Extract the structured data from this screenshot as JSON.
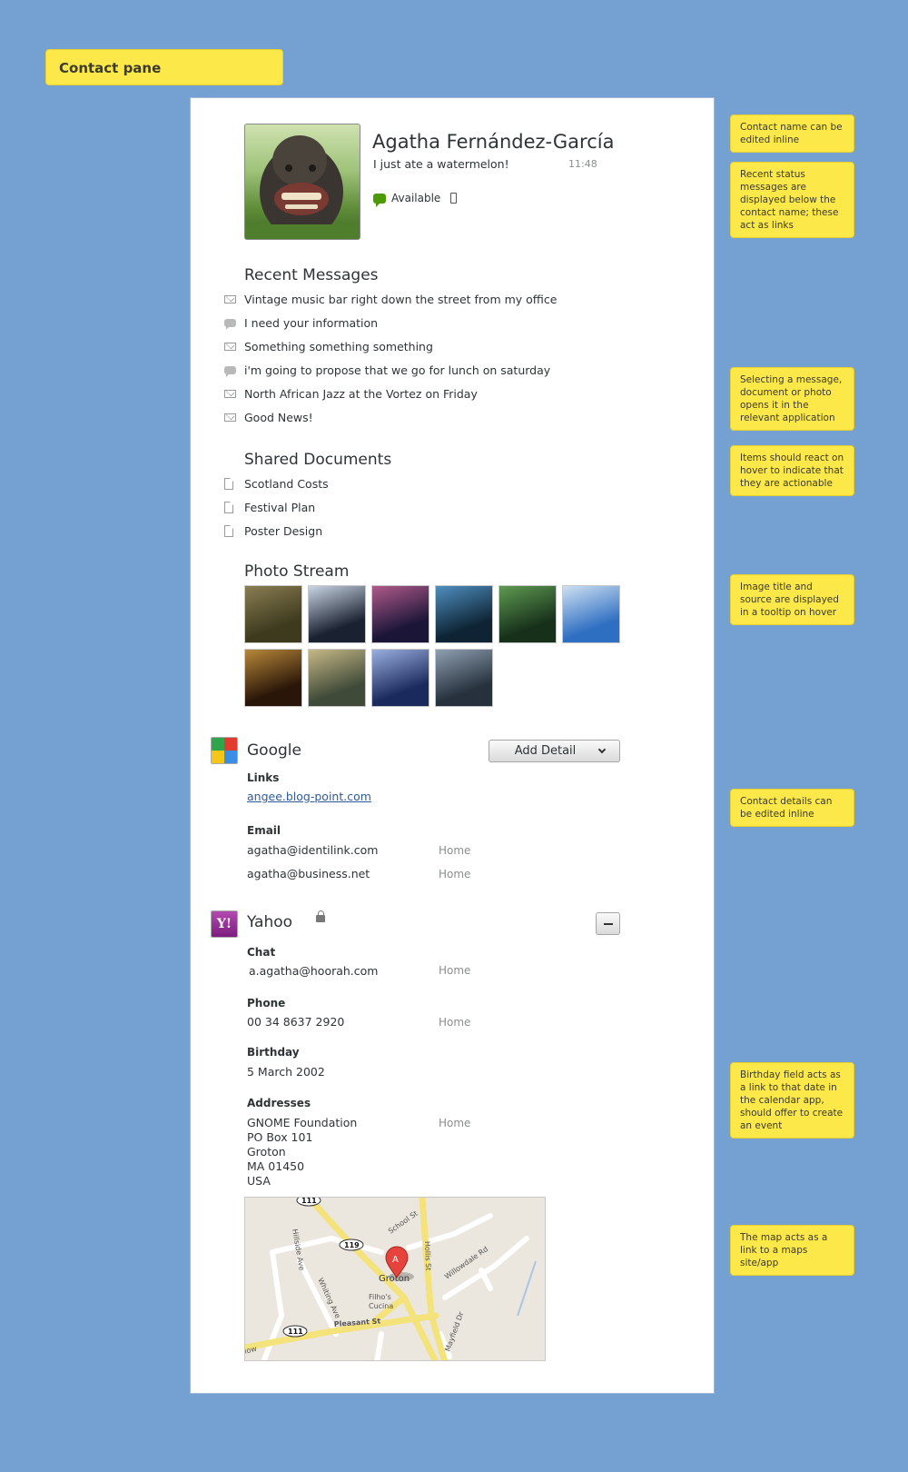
{
  "title": "Contact pane",
  "notes": [
    "Contact name can be edited inline",
    "Recent status messages are displayed below the contact name; these act as links",
    "Selecting a message, document or photo opens it in the relevant application",
    "Items should react on hover to indicate that they are actionable",
    "Image title and source are displayed in a tooltip on hover",
    "Contact details can be edited inline",
    "Birthday field acts as a link to that date in the calendar app, should offer to create an event",
    "The map acts as a link to a maps site/app"
  ],
  "contact": {
    "name": "Agatha Fernández-García",
    "status_message": "I just ate a watermelon!",
    "status_time": "11:48",
    "presence": "Available"
  },
  "recent_messages": {
    "heading": "Recent Messages",
    "items": [
      {
        "type": "mail-icon",
        "text": "Vintage music bar right down the street from my office"
      },
      {
        "type": "chat-icon",
        "text": "I need your information"
      },
      {
        "type": "mail-icon",
        "text": "Something something something"
      },
      {
        "type": "chat-icon",
        "text": "i'm going to propose that we go for lunch on saturday"
      },
      {
        "type": "mail-icon",
        "text": "North African Jazz at the Vortez on Friday"
      },
      {
        "type": "mail-icon",
        "text": "Good News!"
      }
    ]
  },
  "shared_documents": {
    "heading": "Shared Documents",
    "items": [
      "Scotland Costs",
      "Festival Plan",
      "Poster Design"
    ]
  },
  "photo_stream": {
    "heading": "Photo Stream",
    "colors": [
      [
        "#3d3a1e",
        "#8a7d52"
      ],
      [
        "#1a2130",
        "#c9d6e4"
      ],
      [
        "#1b1538",
        "#b05a8a"
      ],
      [
        "#0e2435",
        "#4f8fbf"
      ],
      [
        "#16301a",
        "#5f9a52"
      ],
      [
        "#2f6fc2",
        "#cfe0f2"
      ],
      [
        "#2a1608",
        "#b8883a"
      ],
      [
        "#3f4a38",
        "#c7b887"
      ],
      [
        "#1b2a5c",
        "#9ab0e0"
      ],
      [
        "#26313d",
        "#8fa0b2"
      ]
    ]
  },
  "google": {
    "name": "Google",
    "add_detail_label": "Add Detail",
    "links_label": "Links",
    "link": "angee.blog-point.com",
    "email_label": "Email",
    "emails": [
      {
        "value": "agatha@identilink.com",
        "type": "Home"
      },
      {
        "value": "agatha@business.net",
        "type": "Home"
      }
    ]
  },
  "yahoo": {
    "name": "Yahoo",
    "logo_text": "Y!",
    "chat_label": "Chat",
    "chat_value": "a.agatha@hoorah.com",
    "chat_type": "Home",
    "phone_label": "Phone",
    "phone_value": "00 34 8637 2920",
    "phone_type": "Home",
    "birthday_label": "Birthday",
    "birthday_value": "5 March 2002",
    "addresses_label": "Addresses",
    "address_lines": [
      "GNOME Foundation",
      "PO Box 101",
      "Groton",
      "MA 01450",
      "USA"
    ],
    "address_type": "Home"
  },
  "map": {
    "labels": [
      "School St",
      "Hollis St",
      "Hillside Ave",
      "Whiting Ave",
      "Willowdale Rd",
      "Groton",
      "Filho's Cucina",
      "Pleasant St",
      "Mayfield Dr",
      "low"
    ],
    "route_shields": [
      "111",
      "119",
      "111"
    ],
    "marker": "A"
  }
}
